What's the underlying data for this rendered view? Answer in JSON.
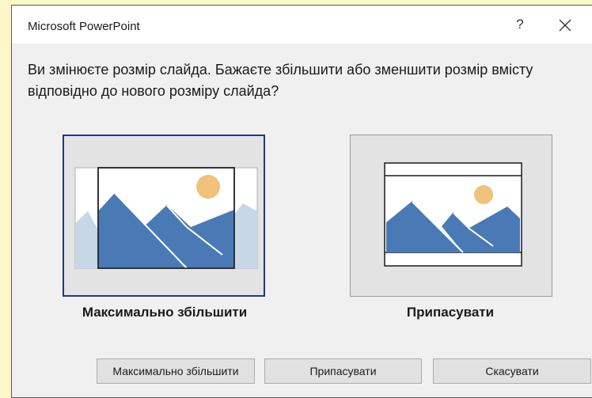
{
  "dialog": {
    "title": "Microsoft PowerPoint",
    "help_label": "?",
    "message": "Ви змінюєте розмір слайда. Бажаєте збільшити або зменшити розмір вмісту відповідно до нового розміру слайда?"
  },
  "options": {
    "maximize_label": "Максимально збільшити",
    "fit_label": "Припасувати"
  },
  "buttons": {
    "maximize": "Максимально збільшити",
    "fit": "Припасувати",
    "cancel": "Скасувати"
  },
  "colors": {
    "mountain": "#4a7ab5",
    "mountain_faded": "#c8d7e8",
    "sun": "#f0c27b",
    "selected_border": "#1f3a7a"
  },
  "icons": {
    "close": "close-icon",
    "help": "help-icon",
    "maximize_preview": "maximize-preview-icon",
    "fit_preview": "fit-preview-icon"
  }
}
